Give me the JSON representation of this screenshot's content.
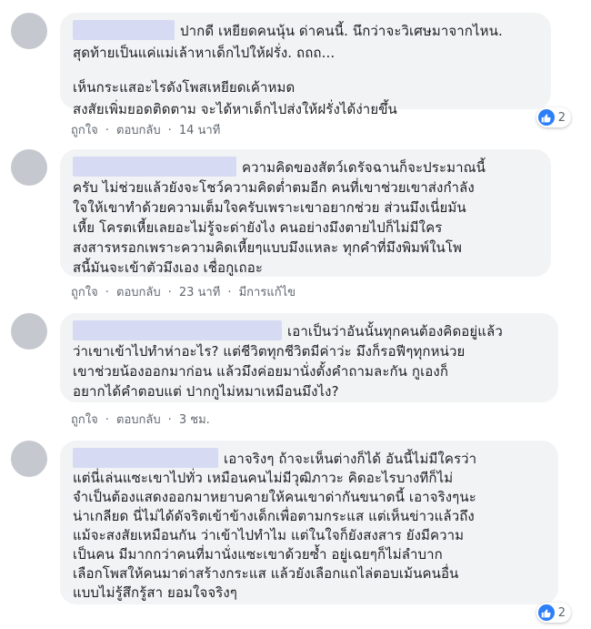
{
  "actions": {
    "like": "ถูกใจ",
    "reply": "ตอบกลับ",
    "edited": "มีการแก้ไข"
  },
  "colors": {
    "bubble": "#f2f3f5",
    "name_redaction": "#d6dbf3",
    "like_blue": "#2d7ff9"
  },
  "comments": [
    {
      "lines": [
        "ปากดี เหยียดคนนุ้น ด่าคนนี้. นึกว่าจะวิเศษมาจากไหน.",
        "สุดท้ายเป็นแค่แม่เล้าหาเด็กไปให้ฝรั่ง. ถถถ...",
        "",
        "เห็นกระแสอะไรดังโพสเหยียดเค้าหมด",
        "สงสัยเพิ่มยอดติดตาม จะได้หาเด็กไปส่งให้ฝรั่งได้ง่ายขึ้น"
      ],
      "time": "14 นาที",
      "reactions": "2"
    },
    {
      "lines": [
        "ความคิดของสัตว์เดรัจฉานก็จะประมาณนี้",
        "ครับ ไม่ช่วยแล้วยังจะโชว์ความคิดต่ำตมอีก คนที่เขาช่วยเขาส่งกำลัง",
        "ใจให้เขาทำด้วยความเต็มใจครับเพราะเขาอยากช่วย ส่วนมึงเนี่ยมัน",
        "เหี้ย โครตเหี้ยเลยอะไม่รู้จะด่ายังไง คนอย่างมึงตายไปก็ไม่มีใคร",
        "สงสารหรอกเพราะความคิดเหี้ยๆแบบมึงแหละ ทุกคำที่มึงพิมพ์ในโพ",
        "สนี้มันจะเข้าตัวมึงเอง เชื่อกูเถอะ"
      ],
      "time": "23 นาที",
      "reactions": ""
    },
    {
      "lines": [
        "เอาเป็นว่าอันนั้นทุกคนต้องคิดอยู่แล้ว",
        "ว่าเขาเข้าไปทำห่าอะไร? แต่ชีวิตทุกชีวิตมีค่าว่ะ มึงก็รอฟีๆทุกหน่วย",
        "เขาช่วยน้องออกมาก่อน แล้วมึงค่อยมานั่งตั้งคำถามละกัน กูเองก็",
        "อยากได้คำตอบแต่ ปากกูไม่หมาเหมือนมึงไง?"
      ],
      "time": "3 ชม.",
      "reactions": ""
    },
    {
      "lines": [
        "เอาจริงๆ ถ้าจะเห็นต่างก็ได้ อันนี้ไม่มีใครว่า",
        "แต่นี่เล่นแซะเขาไปทั่ว เหมือนคนไม่มีวุฒิภาวะ คิดอะไรบางทีก็ไม่",
        "จำเป็นต้องแสดงออกมาหยาบคายให้คนเขาด่ากันขนาดนี้ เอาจริงๆนะ",
        "น่าเกลียด นี่ไม่ได้ดัจริตเข้าข้างเด็กเพื่อตามกระแส แต่เห็นข่าวแล้วถึง",
        "แม้จะสงสัยเหมือนกัน ว่าเข้าไปทำไม แต่ในใจก็ยังสงสาร ยังมีความ",
        "เป็นคน มีมากกว่าคนที่มานั่งแซะเขาด้วยซ้ำ อยู่เฉยๆก็ไม่ลำบาก",
        "เลือกโพสให้คนมาด่าสร้างกระแส แล้วยังเลือกแถไล่ตอบเม้นคนอื่น",
        "แบบไม่รู้สึกรู้สา ยอมใจจริงๆ"
      ],
      "time": "",
      "reactions": "2"
    }
  ]
}
